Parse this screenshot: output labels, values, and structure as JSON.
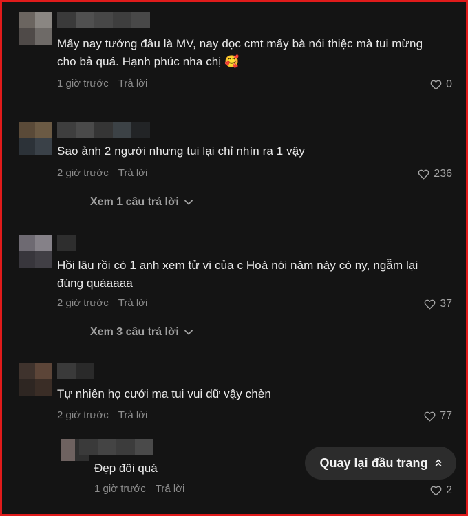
{
  "comments": [
    {
      "text": "Mấy nay tưởng đâu là MV, nay dọc cmt mấy bà nói thiệc mà tui mừng cho bả quá. Hạnh phúc nha chị 🥰",
      "time": "1 giờ trước",
      "reply_label": "Trả lời",
      "likes": "0"
    },
    {
      "text": "Sao ảnh 2 người nhưng tui lại chỉ nhìn ra 1 vậy",
      "time": "2 giờ trước",
      "reply_label": "Trả lời",
      "likes": "236",
      "view_replies": "Xem 1 câu trả lời"
    },
    {
      "text": "Hồi lâu rồi có 1 anh xem tử vi của c Hoà nói năm này có ny, ngẫm lại đúng quáaaaa",
      "time": "2 giờ trước",
      "reply_label": "Trả lời",
      "likes": "37",
      "view_replies": "Xem 3 câu trả lời"
    },
    {
      "text": "Tự nhiên họ cưới ma tui vui dữ vậy chèn",
      "time": "2 giờ trước",
      "reply_label": "Trả lời",
      "likes": "77"
    }
  ],
  "reply": {
    "text": "Đẹp đôi quá",
    "time": "1 giờ trước",
    "reply_label": "Trả lời",
    "likes": "2"
  },
  "back_to_top": "Quay lại đầu trang",
  "colors": {
    "background": "#141414",
    "frame_border": "#e01b1b",
    "text": "#eaeaea",
    "meta": "#8d8d8d"
  },
  "icons": {
    "like": "heart-outline-icon",
    "expand": "chevron-down-icon",
    "back_to_top": "double-chevron-up-icon"
  }
}
